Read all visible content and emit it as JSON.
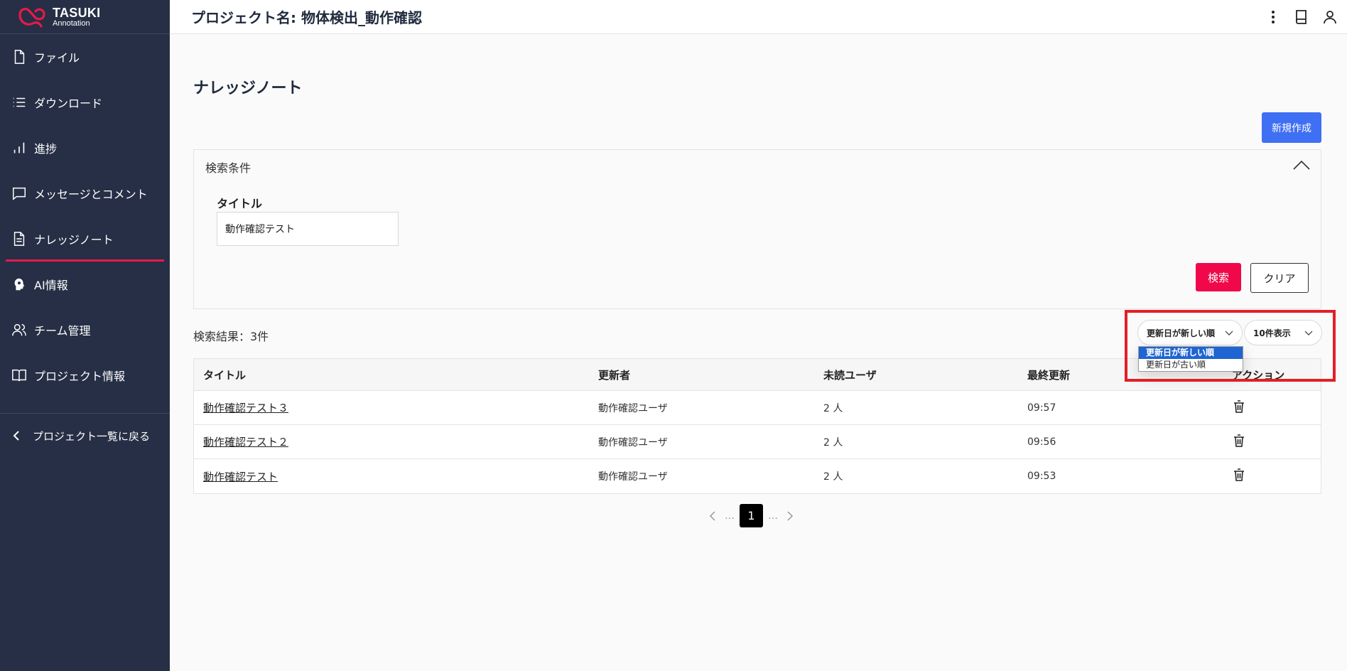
{
  "brand": {
    "name": "TASUKI",
    "sub": "Annotation",
    "accent": "#e8194a"
  },
  "header": {
    "title": "プロジェクト名: 物体検出_動作確認",
    "icons": [
      "more-vert-icon",
      "book-icon",
      "user-icon"
    ]
  },
  "sidebar": {
    "items": [
      {
        "label": "ファイル",
        "icon": "file-icon"
      },
      {
        "label": "ダウンロード",
        "icon": "list-icon"
      },
      {
        "label": "進捗",
        "icon": "bar-chart-icon"
      },
      {
        "label": "メッセージとコメント",
        "icon": "message-icon"
      },
      {
        "label": "ナレッジノート",
        "icon": "document-icon",
        "active": true
      },
      {
        "label": "AI情報",
        "icon": "ai-head-icon"
      },
      {
        "label": "チーム管理",
        "icon": "team-icon"
      },
      {
        "label": "プロジェクト情報",
        "icon": "book-open-icon"
      }
    ],
    "back_label": "プロジェクト一覧に戻る"
  },
  "main": {
    "title": "ナレッジノート",
    "new_button": "新規作成",
    "search": {
      "heading": "検索条件",
      "title_label": "タイトル",
      "title_value": "動作確認テスト",
      "search_button": "検索",
      "clear_button": "クリア"
    },
    "result_count": "検索結果：3件",
    "sort": {
      "selected": "更新日が新しい順",
      "options": [
        "更新日が新しい順",
        "更新日が古い順"
      ]
    },
    "per_page": {
      "selected": "10件表示"
    },
    "table": {
      "headers": [
        "タイトル",
        "更新者",
        "未読ユーザ",
        "最終更新",
        "アクション"
      ],
      "rows": [
        {
          "title": "動作確認テスト３",
          "updater": "動作確認ユーザ",
          "unread": "2 人",
          "updated": "09:57"
        },
        {
          "title": "動作確認テスト２",
          "updater": "動作確認ユーザ",
          "unread": "2 人",
          "updated": "09:56"
        },
        {
          "title": "動作確認テスト",
          "updater": "動作確認ユーザ",
          "unread": "2 人",
          "updated": "09:53"
        }
      ]
    },
    "pagination": {
      "dots_left": "…",
      "current": "1",
      "dots_right": "…"
    }
  }
}
